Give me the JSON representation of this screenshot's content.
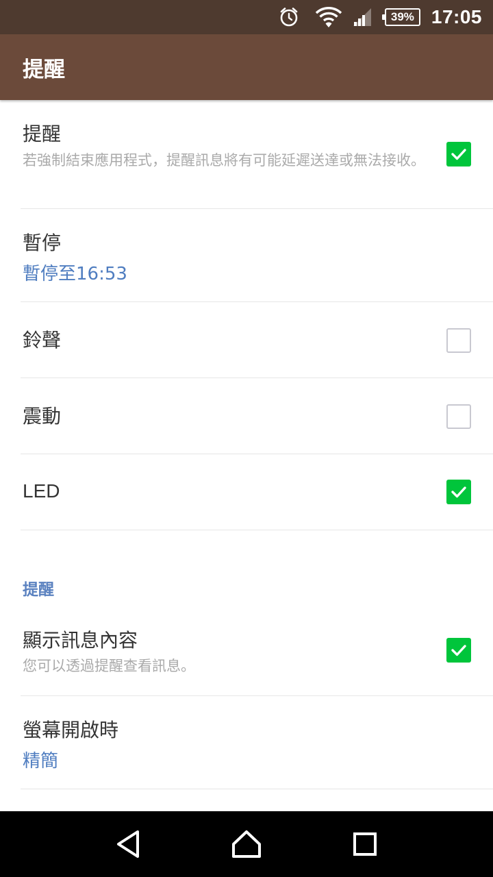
{
  "status_bar": {
    "battery": "39%",
    "time": "17:05",
    "icons": [
      "alarm-icon",
      "wifi-icon",
      "signal-icon",
      "battery-icon"
    ]
  },
  "app_bar": {
    "title": "提醒"
  },
  "settings": {
    "notifications": {
      "title": "提醒",
      "subtitle": "若強制結束應用程式，提醒訊息將有可能延遲送達或無法接收。",
      "checked": true
    },
    "pause": {
      "title": "暫停",
      "value": "暫停至16:53"
    },
    "ringtone": {
      "title": "鈴聲",
      "checked": false
    },
    "vibrate": {
      "title": "震動",
      "checked": false
    },
    "led": {
      "title": "LED",
      "checked": true
    }
  },
  "section_header": "提醒",
  "settings2": {
    "show_content": {
      "title": "顯示訊息內容",
      "subtitle": "您可以透過提醒查看訊息。",
      "checked": true
    },
    "screen_on": {
      "title": "螢幕開啟時",
      "value": "精簡"
    }
  },
  "colors": {
    "status_bar": "#4e3a2f",
    "app_bar": "#6b4a3a",
    "accent_green": "#00c53b",
    "link_blue": "#4f7dc0"
  }
}
